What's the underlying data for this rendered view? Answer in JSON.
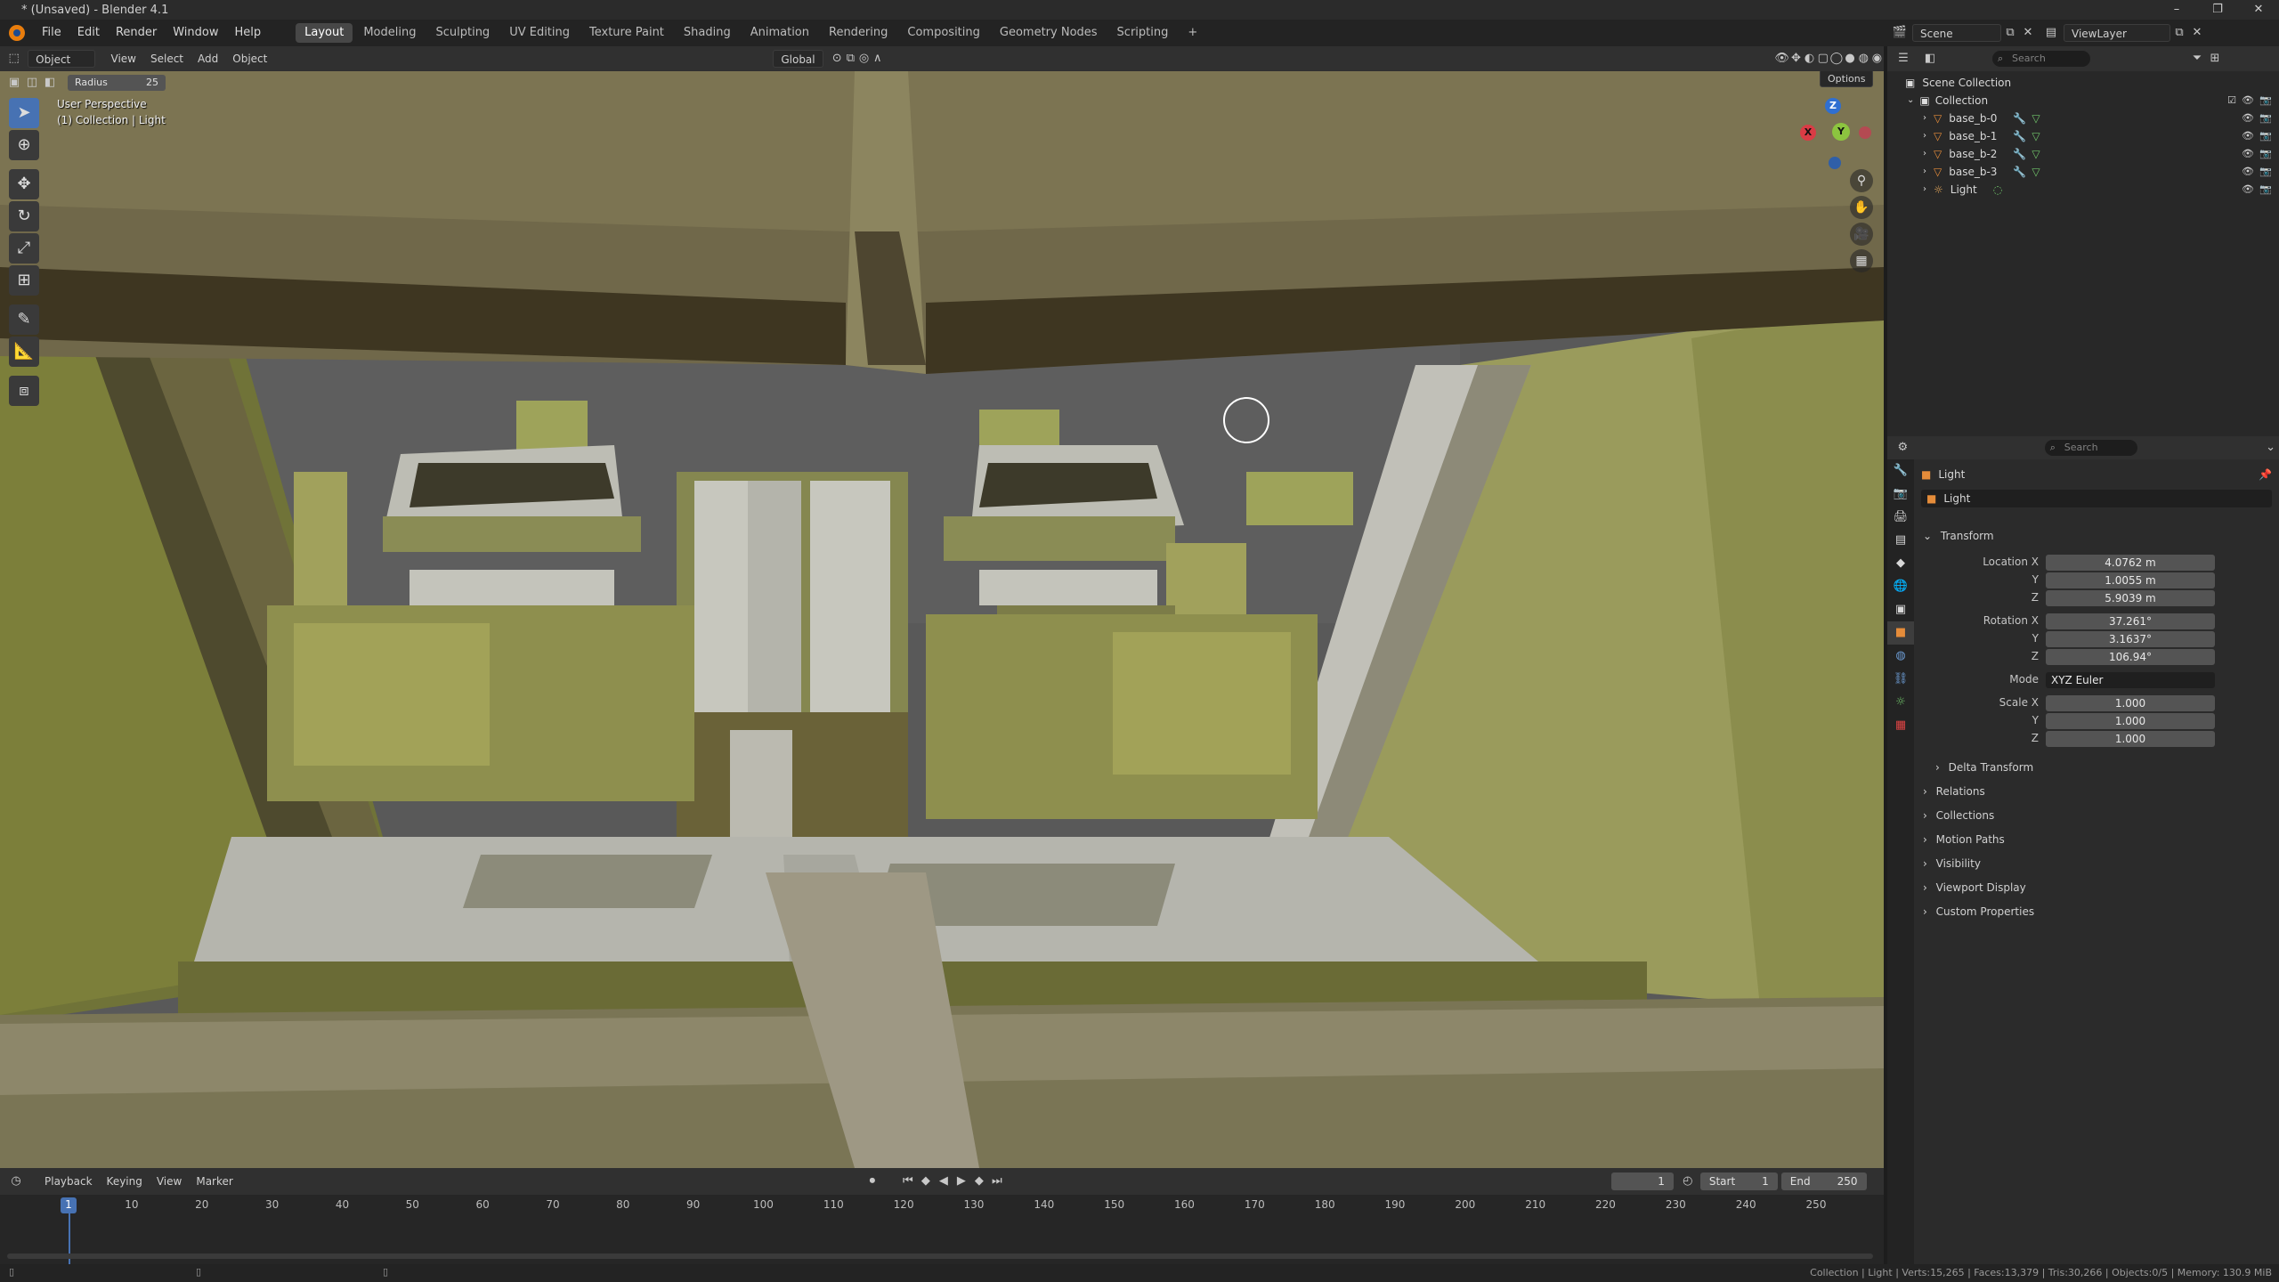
{
  "window": {
    "title": "* (Unsaved) - Blender 4.1",
    "controls": [
      "–",
      "❐",
      "✕"
    ]
  },
  "menubar": {
    "menus": [
      "File",
      "Edit",
      "Render",
      "Window",
      "Help"
    ],
    "workspace_tabs": [
      "Layout",
      "Modeling",
      "Sculpting",
      "UV Editing",
      "Texture Paint",
      "Shading",
      "Animation",
      "Rendering",
      "Compositing",
      "Geometry Nodes",
      "Scripting"
    ],
    "active_workspace": "Layout",
    "add_tab": "+"
  },
  "viewport_header": {
    "mode": "Object Mode",
    "menus": [
      "View",
      "Select",
      "Add",
      "Object"
    ],
    "orientation": "Global",
    "options_label": "Options"
  },
  "tool_settings": {
    "radius_label": "Radius",
    "radius_value": "25"
  },
  "viewport": {
    "view_name": "User Perspective",
    "view_context": "(1) Collection | Light",
    "gizmo": {
      "x": "X",
      "y": "Y",
      "z": "Z"
    },
    "colors": {
      "background": "#5a5a5a",
      "olive": "#6b6d3c",
      "bright_olive": "#8f9440",
      "stone": "#a9a9a0",
      "dark": "#3b3620"
    }
  },
  "timeline": {
    "menus": [
      "Playback",
      "Keying",
      "View",
      "Marker"
    ],
    "current_frame": "1",
    "start_label": "Start",
    "start_value": "1",
    "end_label": "End",
    "end_value": "250",
    "ticks": [
      "1",
      "10",
      "20",
      "30",
      "40",
      "50",
      "60",
      "70",
      "80",
      "90",
      "100",
      "110",
      "120",
      "130",
      "140",
      "150",
      "160",
      "170",
      "180",
      "190",
      "200",
      "210",
      "220",
      "230",
      "240",
      "250"
    ]
  },
  "statusbar": {
    "stats": "Collection | Light | Verts:15,265 | Faces:13,379 | Tris:30,266 | Objects:0/5 | Memory: 130.9 MiB"
  },
  "outliner": {
    "scene_label": "Scene",
    "viewlayer_label": "ViewLayer",
    "search_placeholder": "Search",
    "scene_collection": "Scene Collection",
    "collection": "Collection",
    "objects": [
      {
        "name": "base_b-0",
        "type": "mesh"
      },
      {
        "name": "base_b-1",
        "type": "mesh"
      },
      {
        "name": "base_b-2",
        "type": "mesh"
      },
      {
        "name": "base_b-3",
        "type": "mesh"
      },
      {
        "name": "Light",
        "type": "light"
      }
    ]
  },
  "properties": {
    "search_placeholder": "Search",
    "object_name": "Light",
    "datablock_name": "Light",
    "transform_label": "Transform",
    "location_label": "Location X",
    "location": [
      "4.0762 m",
      "1.0055 m",
      "5.9039 m"
    ],
    "rotation_label": "Rotation X",
    "rotation": [
      "37.261°",
      "3.1637°",
      "106.94°"
    ],
    "mode_label": "Mode",
    "mode_value": "XYZ Euler",
    "scale_label": "Scale X",
    "scale": [
      "1.000",
      "1.000",
      "1.000"
    ],
    "axis_y": "Y",
    "axis_z": "Z",
    "collapsed_panels": [
      "Delta Transform",
      "Relations",
      "Collections",
      "Motion Paths",
      "Visibility",
      "Viewport Display",
      "Custom Properties"
    ]
  }
}
